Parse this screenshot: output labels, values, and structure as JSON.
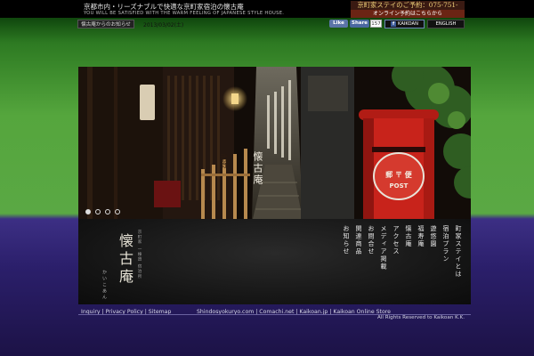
{
  "header": {
    "tagline_jp": "京都市内・リーズナブルで快適な京町家宿泊の懐古庵",
    "tagline_en": "YOU WILL BE SATISFIED WITH THE WARM FEELING OF JAPANESE STYLE HOUSE.",
    "phone": "京町家ステイのご予約：075-751-1005",
    "online_booking": "オンライン予約はこちらから"
  },
  "newsbar": {
    "label": "懐古庵からのお知らせ",
    "date": "2013/03/02(土)"
  },
  "social": {
    "like": "Like",
    "share": "Share",
    "share_count": "157",
    "kaikoan": "KAIKOAN",
    "english": "ENGLISH"
  },
  "hero": {
    "sign_text": "武野",
    "postbox_kanji": "郵 〒 便",
    "postbox_en": "POST",
    "overlay_title": "懐古庵",
    "slides": 4,
    "active_slide": 1
  },
  "logo": {
    "title": "懐古庵",
    "reading": "かいこあん",
    "subtitle": "京町家 一棟貸 宿泊所"
  },
  "nav": [
    "町家ステイとは",
    "宿泊プラン",
    "遊悠園",
    "福寿庵",
    "懐古庵",
    "アクセス",
    "メディア掲載",
    "お問合せ",
    "関連商品",
    "お知らせ"
  ],
  "footer": {
    "links": [
      "Inquiry",
      "Privacy Policy",
      "Sitemap"
    ],
    "sites": [
      "Shindosyokuryo.com",
      "Comachi.net",
      "Kaikoan.jp",
      "Kaikoan Online Store"
    ],
    "copyright": "All Rights Reserved to Kaikoan K.K."
  },
  "colors": {
    "green_band": "#55a63d",
    "purple_band": "#2b1f6b",
    "postbox_red": "#c8231b",
    "panel_dark": "#141414"
  }
}
